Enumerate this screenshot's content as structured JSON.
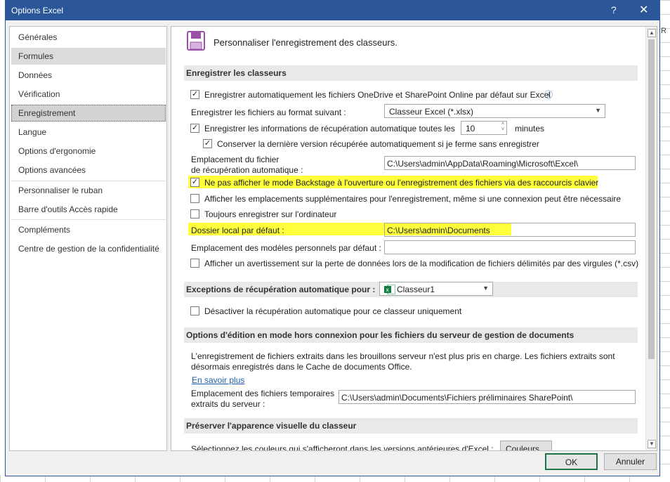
{
  "window": {
    "title": "Options Excel",
    "help": "?",
    "close": "✕"
  },
  "background": {
    "col_letter": "R"
  },
  "sidebar": {
    "items": [
      "Générales",
      "Formules",
      "Données",
      "Vérification",
      "Enregistrement",
      "Langue",
      "Options d'ergonomie",
      "Options avancées",
      "Personnaliser le ruban",
      "Barre d'outils Accès rapide",
      "Compléments",
      "Centre de gestion de la confidentialité"
    ]
  },
  "content": {
    "header": "Personnaliser l'enregistrement des classeurs.",
    "sections": {
      "save": "Enregistrer les classeurs",
      "exceptions": "Exceptions de récupération automatique pour :",
      "offline": "Options d'édition en mode hors connexion pour les fichiers du serveur de gestion de documents",
      "visual": "Préserver l'apparence visuelle du classeur"
    },
    "autosave_onedrive": "Enregistrer automatiquement les fichiers OneDrive et SharePoint Online par défaut sur Excel",
    "info_icon": "ⓘ",
    "format_label": "Enregistrer les fichiers au format suivant :",
    "format_value": "Classeur Excel (*.xlsx)",
    "autorecover_label": "Enregistrer les informations de récupération automatique toutes les",
    "autorecover_minutes": "10",
    "minutes_label": "minutes",
    "keep_last_version": "Conserver la dernière version récupérée automatiquement si je ferme sans enregistrer",
    "autorecover_location_label_1": "Emplacement du fichier",
    "autorecover_location_label_2": "de récupération automatique :",
    "autorecover_location_value": "C:\\Users\\admin\\AppData\\Roaming\\Microsoft\\Excel\\",
    "no_backstage": "Ne pas afficher le mode Backstage à l'ouverture ou l'enregistrement des fichiers via des raccourcis clavier",
    "show_additional_places": "Afficher les emplacements supplémentaires pour l'enregistrement, même si une connexion peut être nécessaire",
    "always_save_computer": "Toujours enregistrer sur l'ordinateur",
    "default_local_label": "Dossier local par défaut :",
    "default_local_value": "C:\\Users\\admin\\Documents",
    "templates_label": "Emplacement des modèles personnels par défaut :",
    "templates_value": "",
    "csv_warning": "Afficher un avertissement sur la perte de données lors de la modification de fichiers délimités par des virgules (*.csv)",
    "exceptions_value": "Classeur1",
    "disable_autorecover": "Désactiver la récupération automatique pour ce classeur uniquement",
    "offline_text_1": "L'enregistrement de fichiers extraits dans les brouillons serveur n'est plus pris en charge. Les fichiers extraits sont",
    "offline_text_2": "désormais enregistrés dans le Cache de documents Office.",
    "learn_more": "En savoir plus",
    "server_drafts_label_1": "Emplacement des fichiers temporaires",
    "server_drafts_label_2": "extraits du serveur :",
    "server_drafts_value": "C:\\Users\\admin\\Documents\\Fichiers préliminaires SharePoint\\",
    "colors_label": "Sélectionnez les couleurs qui s'afficheront dans les versions antérieures d'Excel :",
    "colors_button": "Couleurs..."
  },
  "checks": {
    "autosave_onedrive": true,
    "autorecover": true,
    "keep_last_version": true,
    "no_backstage": true,
    "show_additional_places": false,
    "always_save_computer": false,
    "csv_warning": false,
    "disable_autorecover": false
  },
  "footer": {
    "ok": "OK",
    "cancel": "Annuler"
  },
  "colors": {
    "titlebar": "#2b579a",
    "highlight": "#ffff3c",
    "ok_border": "#217346",
    "link": "#1f5fa8"
  }
}
